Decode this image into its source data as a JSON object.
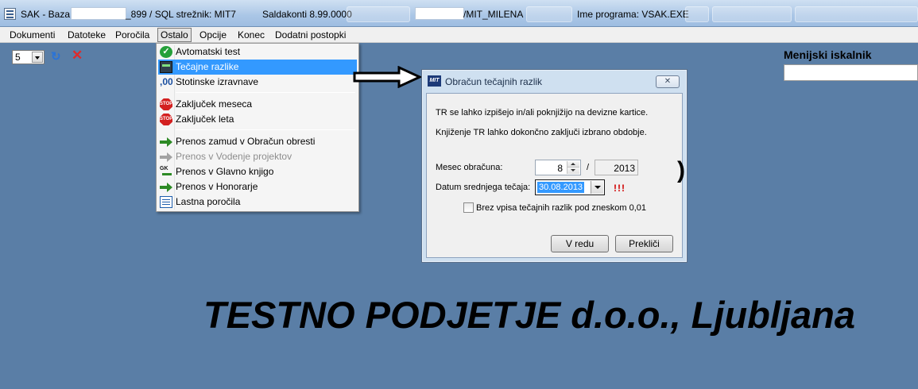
{
  "titlebar": {
    "prefix": "SAK - Baza:",
    "db_suffix": "_899 / SQL strežnik: MIT7",
    "version": "Saldakonti 8.99.0000",
    "user": "/MIT_MILENA",
    "program": "Ime programa: VSAK.EXE"
  },
  "menubar": {
    "items": [
      "Dokumenti",
      "Datoteke",
      "Poročila",
      "Ostalo",
      "Opcije",
      "Konec",
      "Dodatni postopki"
    ]
  },
  "toolbar": {
    "combo_value": "5"
  },
  "dropdown": {
    "items": [
      {
        "label": "Avtomatski test",
        "icon": "check-icon"
      },
      {
        "label": "Tečajne razlike",
        "icon": "calculator-icon"
      },
      {
        "label": "Stotinske izravnave",
        "icon": "cents-icon"
      },
      {
        "label": "Zaključek meseca",
        "icon": "stop-icon"
      },
      {
        "label": "Zaključek leta",
        "icon": "stop-icon"
      },
      {
        "label": "Prenos zamud v Obračun obresti",
        "icon": "arrow-right-icon"
      },
      {
        "label": "Prenos v Vodenje projektov",
        "icon": "arrow-right-icon"
      },
      {
        "label": "Prenos v Glavno knjigo",
        "icon": "gk-icon"
      },
      {
        "label": "Prenos v Honorarje",
        "icon": "arrow-right-icon"
      },
      {
        "label": "Lastna poročila",
        "icon": "list-icon"
      }
    ],
    "stop_icon_text": "STOP",
    "gk_icon_text": "GK"
  },
  "dialog": {
    "logo": "MIT",
    "title": "Obračun tečajnih razlik",
    "info_line1": "TR se lahko izpišejo in/ali poknjižijo na devizne kartice.",
    "info_line2": "Knjiženje TR lahko dokončno zaključi izbrano obdobje.",
    "month_label": "Mesec obračuna:",
    "month_value": "8",
    "separator": "/",
    "year_value": "2013",
    "date_label": "Datum srednjega tečaja:",
    "date_value": "30.08.2013",
    "warning": "!!!",
    "checkbox_label": "Brez vpisa tečajnih razlik pod zneskom 0,01",
    "ok_label": "V redu",
    "cancel_label": "Prekliči"
  },
  "search": {
    "label": "Menijski iskalnik",
    "value": ""
  },
  "company_name": "TESTNO PODJETJE d.o.o., Ljubljana",
  "background_glyph": ")"
}
